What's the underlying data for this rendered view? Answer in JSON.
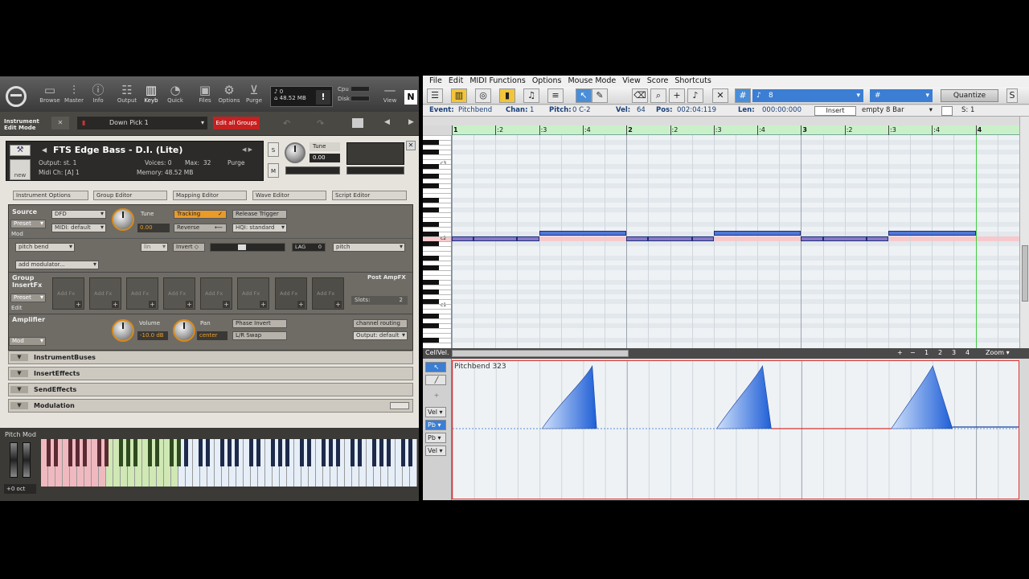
{
  "kontakt": {
    "toolbar": [
      {
        "label": "Browse",
        "icon": "folder-icon"
      },
      {
        "label": "Master",
        "icon": "mixer-icon"
      },
      {
        "label": "Info",
        "icon": "info-icon"
      },
      {
        "label": "Output",
        "icon": "output-icon"
      },
      {
        "label": "Keyb",
        "icon": "keyboard-icon"
      },
      {
        "label": "Quick",
        "icon": "quick-icon"
      },
      {
        "label": "Files",
        "icon": "disk-icon"
      },
      {
        "label": "Options",
        "icon": "gear-icon"
      },
      {
        "label": "Purge",
        "icon": "purge-icon"
      }
    ],
    "meter_voices": "0",
    "meter_memory": "48.52 MB",
    "cpu_label": "Cpu",
    "disk_label": "Disk",
    "view_label": "View",
    "edit_mode_label": "Instrument Edit Mode",
    "preset_name": "Down Pick 1",
    "edit_all_groups": "Edit all Groups",
    "instrument": {
      "name": "FTS Edge Bass - D.I. (Lite)",
      "output": "Output: st. 1",
      "midi_ch": "Midi Ch: [A] 1",
      "voices_label": "Voices:",
      "voices": "0",
      "max_label": "Max:",
      "max": "32",
      "purge": "Purge",
      "memory": "Memory: 48.52 MB",
      "new_label": "new",
      "tune_label": "Tune",
      "tune_value": "0.00"
    },
    "tabs": [
      "Instrument Options",
      "Group Editor",
      "Mapping Editor",
      "Wave Editor",
      "Script Editor"
    ],
    "source": {
      "title": "Source",
      "preset": "Preset",
      "mod": "Mod",
      "engine": "DFD",
      "tune_label": "Tune",
      "tune_value": "0.00",
      "tracking": "Tracking",
      "release_trigger": "Release Trigger",
      "midi_default": "MIDI: default",
      "reverse": "Reverse",
      "hqi": "HQI: standard",
      "pitch_bend": "pitch bend",
      "invert": "Invert",
      "lag_label": "LAG",
      "lag_value": "0",
      "pitch_dd": "pitch",
      "add_modulator": "add modulator..."
    },
    "insert_fx": {
      "title": "Group InsertFx",
      "preset": "Preset",
      "edit": "Edit",
      "slot_label": "Add Fx",
      "post_amp": "Post AmpFX",
      "slots_label": "Slots:",
      "slots": "2"
    },
    "amplifier": {
      "title": "Amplifier",
      "mod": "Mod",
      "volume_label": "Volume",
      "volume_value": "-10.0",
      "volume_unit": "dB",
      "pan_label": "Pan",
      "pan_value": "center",
      "phase_invert": "Phase Invert",
      "lr_swap": "L/R Swap",
      "channel_routing": "channel routing",
      "output_default": "Output: default"
    },
    "folds": [
      "InstrumentBuses",
      "InsertEffects",
      "SendEffects",
      "Modulation"
    ],
    "keyboard": {
      "pitch_mod": "Pitch Mod",
      "octave": "+0 oct"
    }
  },
  "daw": {
    "menus": [
      "File",
      "Edit",
      "MIDI Functions",
      "Options",
      "Mouse Mode",
      "View",
      "Score",
      "Shortcuts"
    ],
    "toolbar": {
      "grid_value": "8",
      "hash_value": "#",
      "quantize": "Quantize",
      "s_label": "S"
    },
    "event_bar": {
      "event_label": "Event:",
      "event_value": "Pitchbend",
      "chan_label": "Chan:",
      "chan_value": "1",
      "pitch_label": "Pitch:",
      "pitch_value": "0 C-2",
      "vel_label": "Vel:",
      "vel_value": "64",
      "pos_label": "Pos:",
      "pos_value": "002:04:119",
      "len_label": "Len:",
      "len_value": "000:00:000",
      "insert": "Insert",
      "length_preset": "empty 8 Bar",
      "s_value": "S: 1"
    },
    "ruler": [
      {
        "label": "1",
        "major": true
      },
      {
        "label": ":2",
        "major": false
      },
      {
        "label": ":3",
        "major": false
      },
      {
        "label": ":4",
        "major": false
      },
      {
        "label": "2",
        "major": true
      },
      {
        "label": ":2",
        "major": false
      },
      {
        "label": ":3",
        "major": false
      },
      {
        "label": ":4",
        "major": false
      },
      {
        "label": "3",
        "major": true
      },
      {
        "label": ":2",
        "major": false
      },
      {
        "label": ":3",
        "major": false
      },
      {
        "label": ":4",
        "major": false
      },
      {
        "label": "4",
        "major": true
      }
    ],
    "piano_labels": {
      "c3": "c3",
      "c2": "c2",
      "c1": "c1"
    },
    "lower_bar": {
      "cell": "Cell",
      "vel": "Vel.",
      "zoom": "Zoom",
      "zoom_steps": [
        "1",
        "2",
        "3",
        "4"
      ]
    },
    "controller": {
      "label": "Pitchbend 323",
      "lanes": [
        "Vel",
        "Pb",
        "Pb",
        "Vel"
      ],
      "colors": {
        "fill": "#1f5fd6",
        "center": "#d33"
      }
    }
  }
}
